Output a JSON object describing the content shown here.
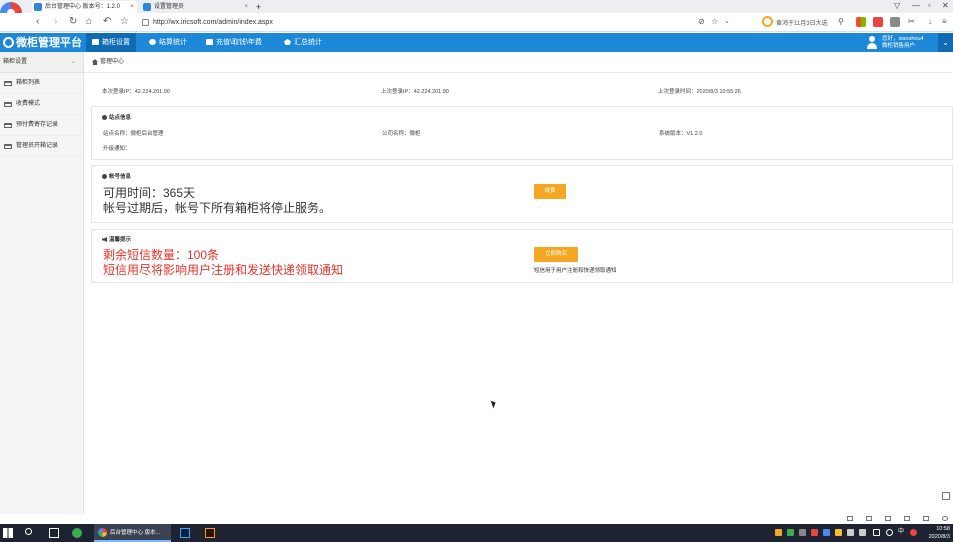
{
  "browser": {
    "tabs": [
      {
        "label": "后台管理中心 版本号：1.2.0",
        "close": "×"
      },
      {
        "label": "设置管理员",
        "close": "×"
      }
    ],
    "new_tab": "+",
    "url": "http://wx.iricsoft.com/admin/index.aspx",
    "news": "黄鸿于11月3日大选",
    "colors": {
      "tabbar": "#eceef2",
      "accent": "#1e88d8"
    }
  },
  "app": {
    "brand": "微柜管理平台",
    "topnav": [
      "箱柜设置",
      "结算统计",
      "充值\\取钱\\年费",
      "汇总统计"
    ],
    "user": {
      "greeting": "您好，xiaoshou4",
      "role": "微柜销售用户"
    }
  },
  "sidebar": {
    "header": "箱柜设置",
    "items": [
      "箱柜列表",
      "收费模式",
      "预付费寄存记录",
      "管理员开箱记录"
    ]
  },
  "breadcrumb": "管理中心",
  "login_info": {
    "this_ip": "本次登录IP：42.224.201.90",
    "last_ip": "上次登录IP：42.224.201.90",
    "last_time": "上次登录时间：2020/8/3 10:55:26"
  },
  "site_panel": {
    "title": "站点信息",
    "site_name": "站点名称：微柜后台管理",
    "company": "公司名称：微柜",
    "version": "系统版本：V1.2.0",
    "upgrade": "升级通知："
  },
  "account_panel": {
    "title": "帐号信息",
    "available": "可用时间：365天",
    "expire_note": "帐号过期后，帐号下所有箱柜将停止服务。",
    "renew_button": "续费"
  },
  "sms_panel": {
    "title": "温馨提示",
    "remaining": "剩余短信数量：100条",
    "warning": "短信用尽将影响用户注册和发送快递领取通知",
    "buy_button": "立即购买",
    "note": "短信用于用户注册和快递领取通知"
  },
  "taskbar": {
    "app_label": "后台管理中心 版本...",
    "time": "10:58",
    "date": "2020/8/3",
    "ime": "中"
  }
}
